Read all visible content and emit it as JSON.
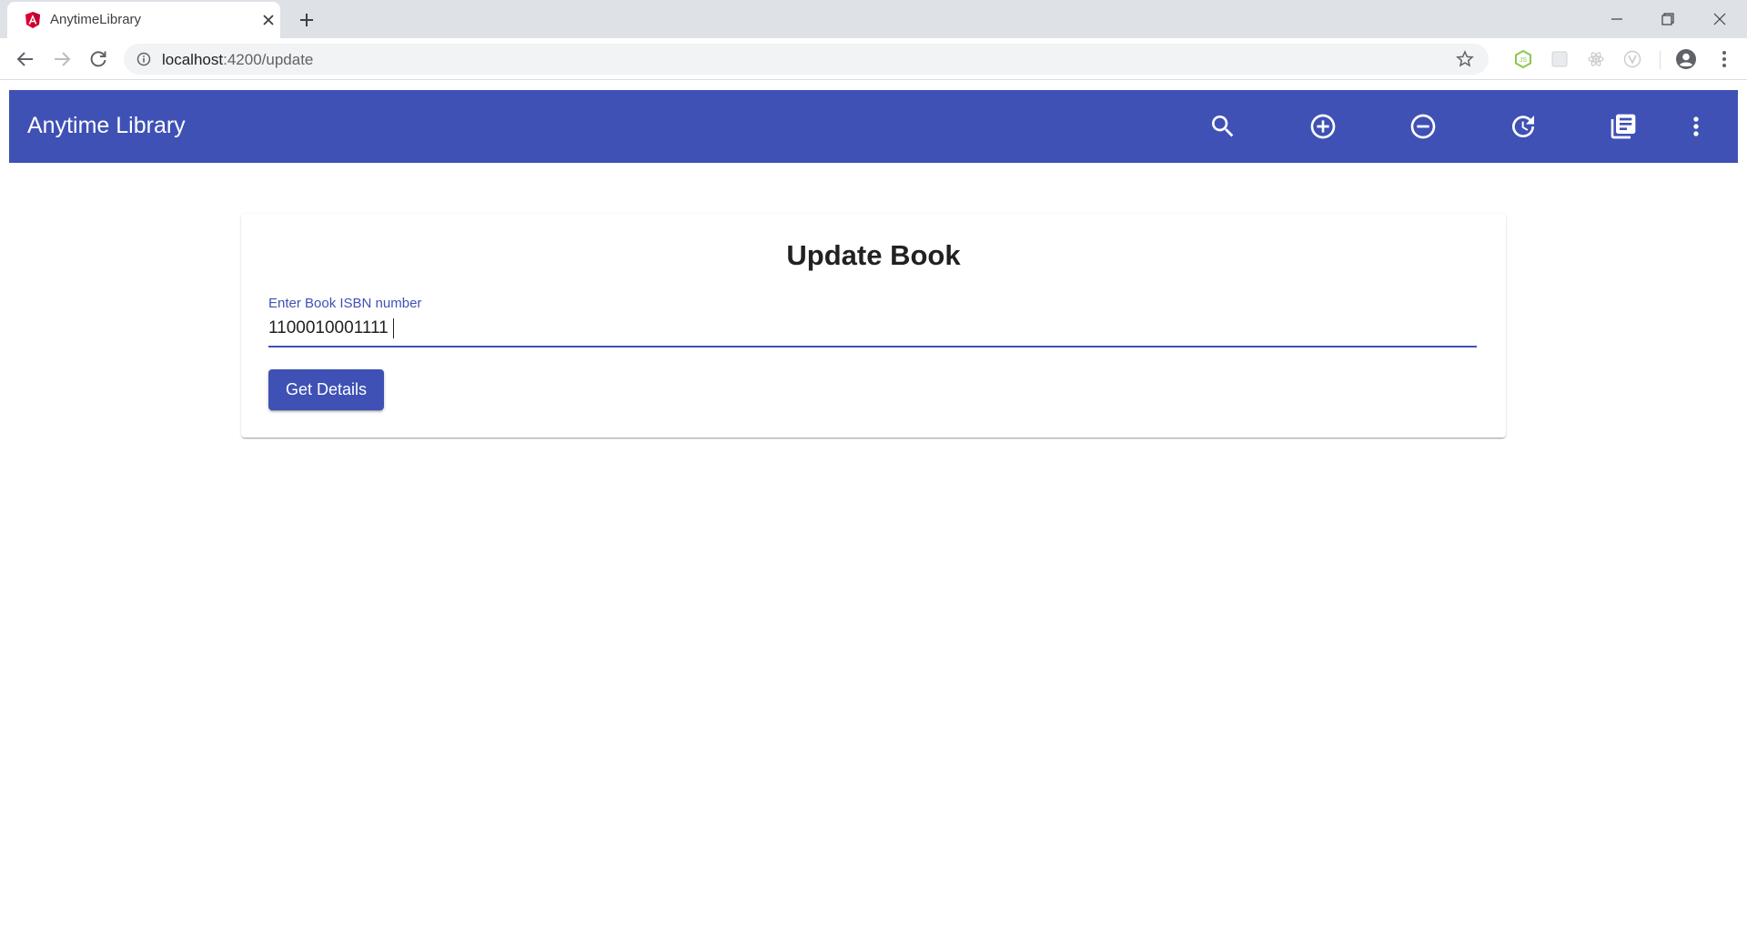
{
  "browser": {
    "tab": {
      "title": "AnytimeLibrary",
      "favicon": "angular-logo-icon"
    },
    "address": {
      "host": "localhost",
      "path": ":4200/update"
    },
    "colors": {
      "tabstrip": "#dee1e6",
      "omnibox": "#f1f3f4"
    }
  },
  "app": {
    "title": "Anytime Library",
    "primary_color": "#3f51b5",
    "toolbar_icons": [
      {
        "name": "search-icon",
        "label": "Search"
      },
      {
        "name": "add-circle-icon",
        "label": "Add"
      },
      {
        "name": "remove-circle-icon",
        "label": "Remove"
      },
      {
        "name": "update-icon",
        "label": "Update"
      },
      {
        "name": "library-books-icon",
        "label": "Books"
      },
      {
        "name": "more-vert-icon",
        "label": "More"
      }
    ]
  },
  "card": {
    "title": "Update Book",
    "isbn_field": {
      "label": "Enter Book ISBN number",
      "value": "1100010001111"
    },
    "get_details_label": "Get Details"
  }
}
